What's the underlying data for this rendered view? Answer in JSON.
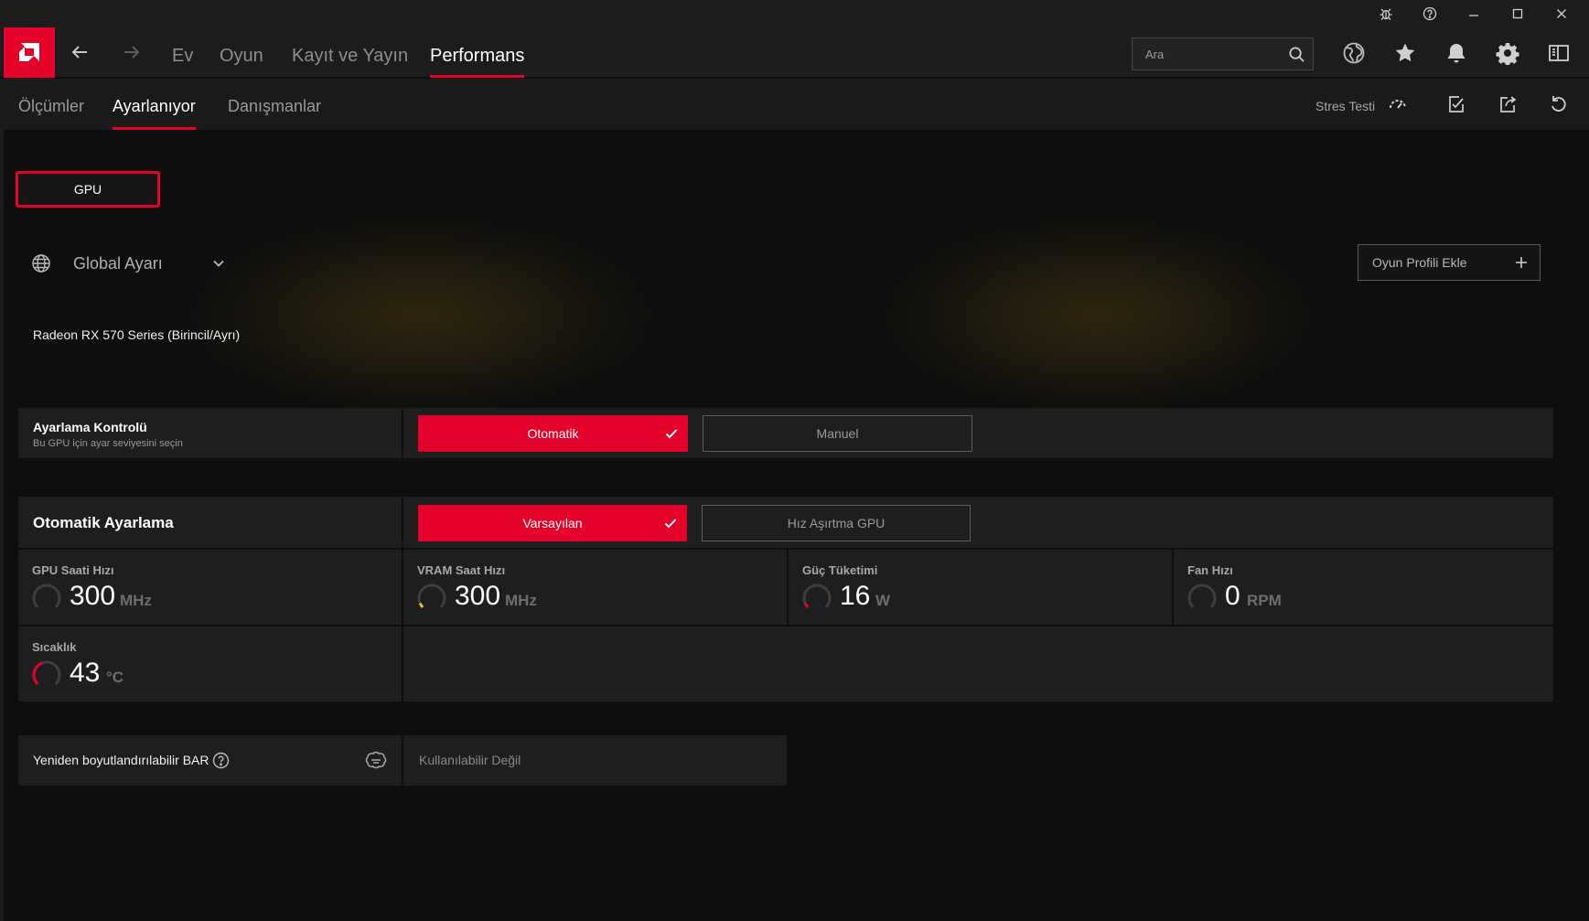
{
  "app": {
    "brand_color": "#e4022b",
    "accent_gauge_color": "#f2c12e"
  },
  "navbar": {
    "tabs": [
      {
        "label": "Ev"
      },
      {
        "label": "Oyun"
      },
      {
        "label": "Kayıt ve Yayın"
      },
      {
        "label": "Performans"
      }
    ],
    "active_tab": "Performans",
    "search": {
      "placeholder": "Ara"
    },
    "icons": [
      "globe-icon",
      "star-icon",
      "bell-icon",
      "gear-icon",
      "sidebar-layout-icon"
    ]
  },
  "titlebar": {
    "icons": [
      "bug-icon",
      "help-icon",
      "minimize-icon",
      "maximize-icon",
      "close-icon"
    ]
  },
  "subnav": {
    "tabs": [
      {
        "label": "Ölçümler"
      },
      {
        "label": "Ayarlanıyor"
      },
      {
        "label": "Danışmanlar"
      }
    ],
    "active_tab": "Ayarlanıyor",
    "stress_test_label": "Stres Testi"
  },
  "gpu_tab": {
    "label": "GPU"
  },
  "profile": {
    "selected": "Global Ayarı",
    "add_button": "Oyun Profili Ekle"
  },
  "device": {
    "name": "Radeon RX 570 Series (Birincil/Ayrı)"
  },
  "tuning_control": {
    "title": "Ayarlama Kontrolü",
    "subtitle": "Bu GPU için ayar seviyesini seçin",
    "options": [
      {
        "label": "Otomatik",
        "selected": true
      },
      {
        "label": "Manuel",
        "selected": false
      }
    ]
  },
  "auto_tuning": {
    "title": "Otomatik Ayarlama",
    "options": [
      {
        "label": "Varsayılan",
        "selected": true
      },
      {
        "label": "Hız Aşırtma GPU",
        "selected": false
      }
    ],
    "metrics": [
      {
        "label": "GPU Saati Hızı",
        "value": "300",
        "unit": "MHz",
        "gauge_level": 0.0,
        "gauge_color": "#4a4a4a"
      },
      {
        "label": "VRAM Saat Hızı",
        "value": "300",
        "unit": "MHz",
        "gauge_level": 0.08,
        "gauge_color": "#f2c12e"
      },
      {
        "label": "Güç Tüketimi",
        "value": "16",
        "unit": "W",
        "gauge_level": 0.08,
        "gauge_color": "#e4022b"
      },
      {
        "label": "Fan Hızı",
        "value": "0",
        "unit": "RPM",
        "gauge_level": 0.0,
        "gauge_color": "#4a4a4a"
      },
      {
        "label": "Sıcaklık",
        "value": "43",
        "unit": "°C",
        "gauge_level": 0.43,
        "gauge_color": "#e4022b"
      }
    ]
  },
  "resizable_bar": {
    "title": "Yeniden boyutlandırılabilir BAR",
    "status": "Kullanılabilir Değil"
  }
}
